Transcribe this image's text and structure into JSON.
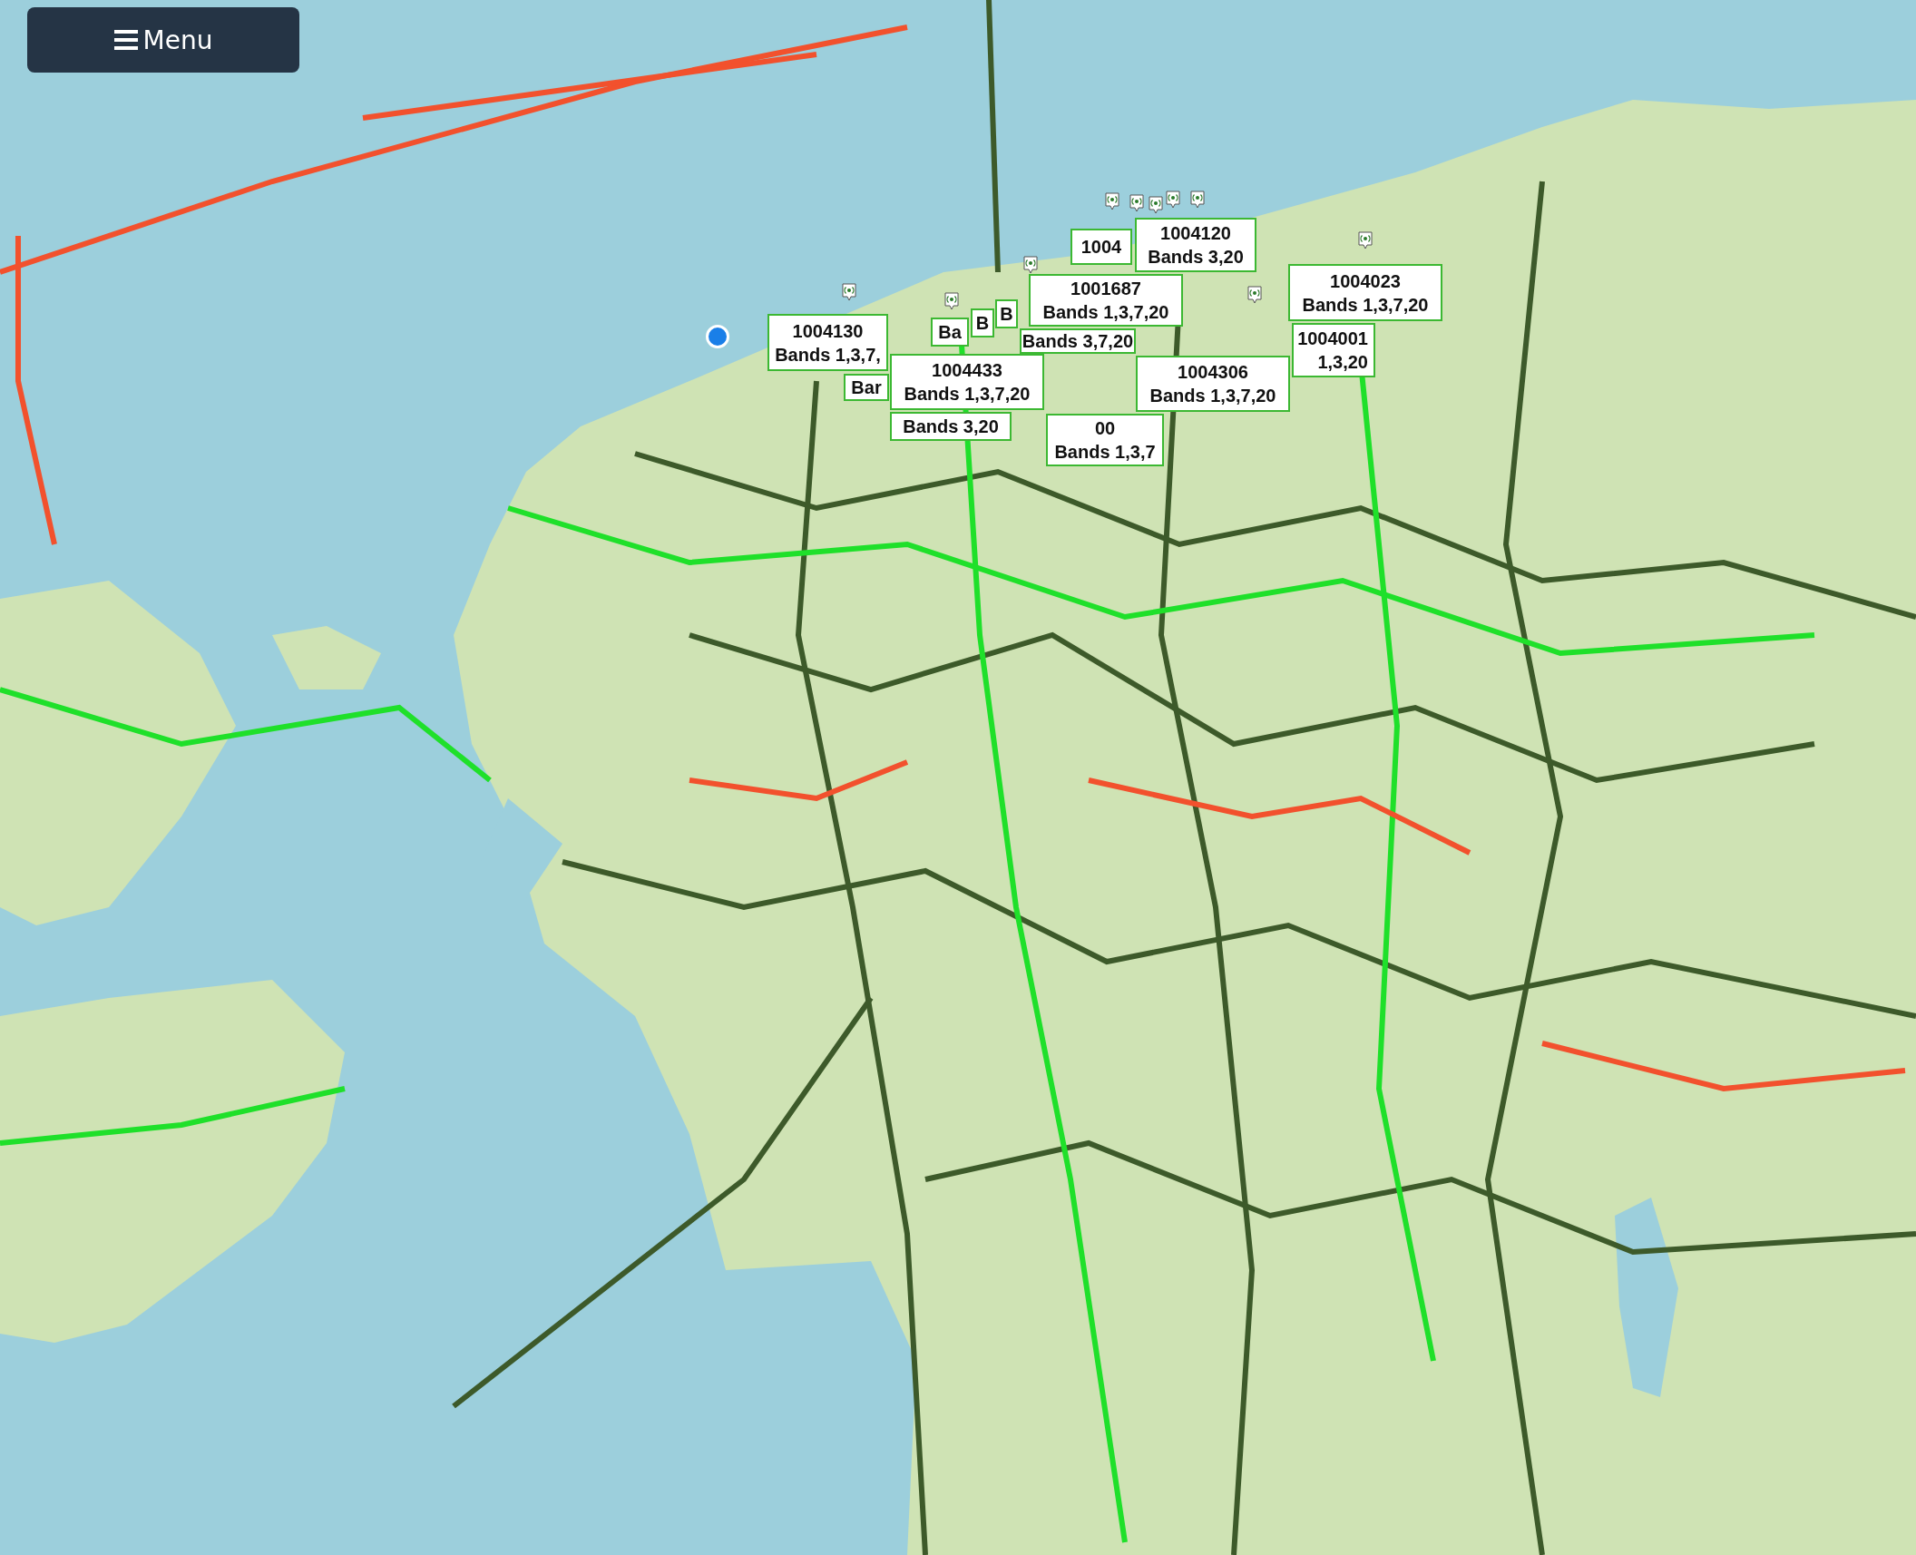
{
  "menu_button": {
    "label": "Menu"
  },
  "cell_labels": [
    {
      "lines": [
        "1004"
      ]
    },
    {
      "lines": [
        "Ba"
      ]
    },
    {
      "lines": [
        "B"
      ]
    },
    {
      "lines": [
        "B"
      ]
    },
    {
      "lines": [
        "Bands 3,7,20"
      ]
    },
    {
      "lines": [
        "1004120",
        "Bands 3,20"
      ]
    },
    {
      "lines": [
        "1001687",
        "Bands 1,3,7,20"
      ]
    },
    {
      "lines": [
        "1004023",
        "Bands 1,3,7,20"
      ]
    },
    {
      "lines": [
        "Bar"
      ]
    },
    {
      "lines": [
        "Bands 3,20"
      ]
    },
    {
      "lines": [
        "00",
        "Bands 1,3,7"
      ]
    },
    {
      "lines": [
        "1004130",
        "Bands 1,3,7,"
      ]
    },
    {
      "lines": [
        "1004001",
        "1,3,20"
      ]
    },
    {
      "lines": [
        "1004433",
        "Bands 1,3,7,20"
      ]
    },
    {
      "lines": [
        "1004306",
        "Bands 1,3,7,20"
      ]
    }
  ]
}
